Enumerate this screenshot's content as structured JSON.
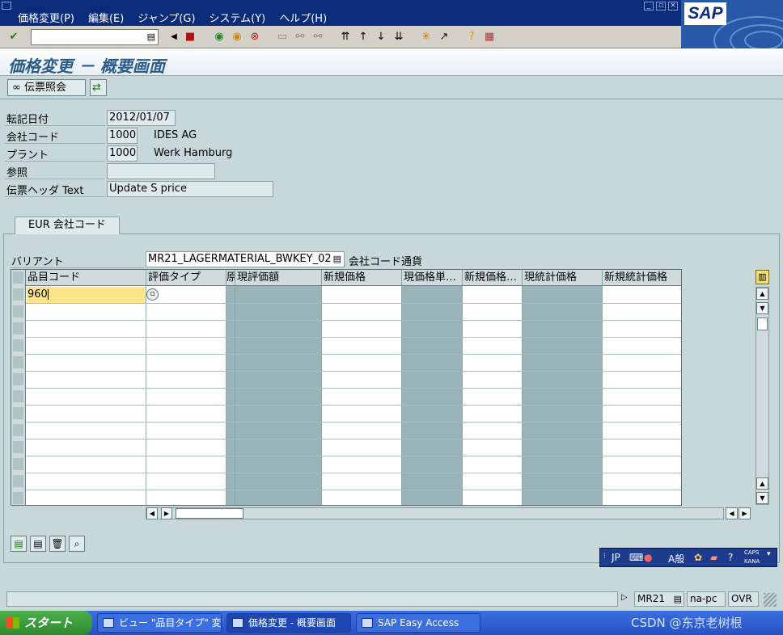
{
  "menubar": {
    "items": [
      "価格変更(P)",
      "編集(E)",
      "ジャンプ(G)",
      "システム(Y)",
      "ヘルプ(H)"
    ],
    "logo": "SAP"
  },
  "toolbar": {
    "command_value": "",
    "icons": [
      "enter-icon",
      "save-icon",
      "back-icon",
      "exit-icon",
      "cancel-icon",
      "print-icon",
      "find-icon",
      "find-next-icon",
      "first-page-icon",
      "previous-page-icon",
      "next-page-icon",
      "last-page-icon",
      "create-session-icon",
      "shortcut-icon",
      "help-icon",
      "layout-icon"
    ]
  },
  "title": "価格変更 － 概要画面",
  "app_toolbar": {
    "document_button": "伝票照会"
  },
  "header_fields": [
    {
      "label": "転記日付",
      "value": "2012/01/07",
      "desc": ""
    },
    {
      "label": "会社コード",
      "value": "1000",
      "desc": "IDES AG"
    },
    {
      "label": "プラント",
      "value": "1000",
      "desc": "Werk Hamburg"
    },
    {
      "label": "参照",
      "value": "",
      "desc": ""
    },
    {
      "label": "伝票ヘッダ Text",
      "value": "Update S price",
      "desc": ""
    }
  ],
  "tab": {
    "label": "EUR  会社コード"
  },
  "variant": {
    "label": "バリアント",
    "value": "MR21_LAGERMATERIAL_BWKEY_02",
    "desc": "会社コード通貨"
  },
  "table": {
    "columns": [
      "品目コード",
      "評価タイプ",
      "原",
      "現評価額",
      "新規価格",
      "現価格単…",
      "新規価格…",
      "現統計価格",
      "新規統計価格"
    ],
    "rows": [
      [
        "960",
        "",
        "",
        "",
        "",
        "",
        "",
        "",
        ""
      ]
    ]
  },
  "ime": {
    "mode": "JP",
    "input_mode": "A般",
    "caps": "CAPS",
    "kana": "KANA"
  },
  "status": {
    "transaction": "MR21",
    "client": "na-pc",
    "insert_mode": "OVR"
  },
  "taskbar": {
    "start": "スタート",
    "tasks": [
      "ビュー \"品目タイプ\" 変...",
      "価格変更 - 概要画面",
      "SAP Easy Access"
    ],
    "watermark": "CSDN @东京老树根"
  },
  "colors": {
    "menubar": "#0a2c7a",
    "background": "#c8d8d8",
    "title": "#2a5a8a",
    "input_highlight": "#fde58a",
    "readonly_column": "#98b4b8"
  }
}
